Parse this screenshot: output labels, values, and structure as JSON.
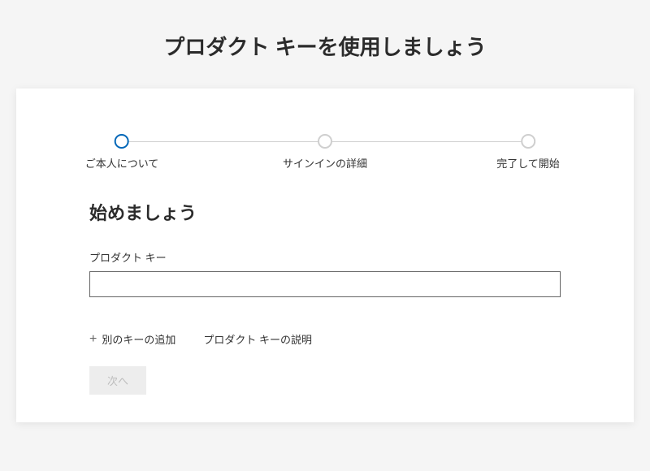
{
  "page": {
    "title": "プロダクト キーを使用しましょう"
  },
  "stepper": {
    "steps": [
      {
        "label": "ご本人について"
      },
      {
        "label": "サインインの詳細"
      },
      {
        "label": "完了して開始"
      }
    ],
    "active_index": 0
  },
  "section": {
    "heading": "始めましょう",
    "product_key_label": "プロダクト キー",
    "product_key_value": ""
  },
  "actions": {
    "add_another_key": "別のキーの追加",
    "product_key_help": "プロダクト キーの説明",
    "next": "次へ"
  }
}
